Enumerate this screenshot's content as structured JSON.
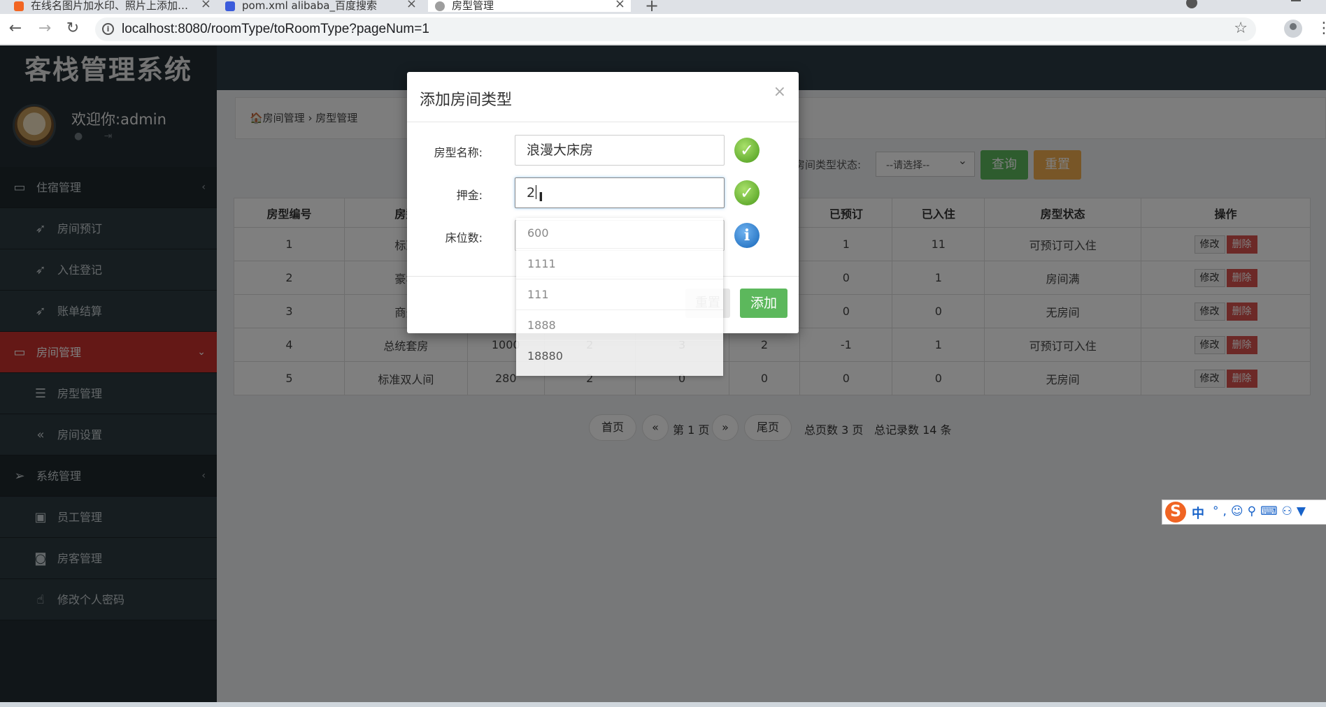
{
  "browser": {
    "tabs": [
      {
        "label": "在线名图片加水印、照片上添加…",
        "color": "#f26522"
      },
      {
        "label": "pom.xml alibaba_百度搜索",
        "color": "#3b5bdb"
      },
      {
        "label": "房型管理",
        "color": "#9e9e9e"
      }
    ],
    "url": "localhost:8080/roomType/toRoomType?pageNum=1"
  },
  "sidebar": {
    "logo": "客栈管理系统",
    "welcome": "欢迎你:admin",
    "menu": [
      {
        "label": "住宿管理",
        "icon": "laptop-icon",
        "glyph": "▭",
        "type": "header",
        "chevron": "‹"
      },
      {
        "label": "房间预订",
        "icon": "rocket-icon",
        "glyph": "➶",
        "type": "sub"
      },
      {
        "label": "入住登记",
        "icon": "rocket-icon",
        "glyph": "➶",
        "type": "sub"
      },
      {
        "label": "账单结算",
        "icon": "rocket-icon",
        "glyph": "➶",
        "type": "sub"
      },
      {
        "label": "房间管理",
        "icon": "desktop-icon",
        "glyph": "▭",
        "type": "active",
        "chevron": "⌄"
      },
      {
        "label": "房型管理",
        "icon": "list-icon",
        "glyph": "☰",
        "type": "sub"
      },
      {
        "label": "房间设置",
        "icon": "double-angle-left-icon",
        "glyph": "«",
        "type": "sub"
      },
      {
        "label": "系统管理",
        "icon": "paper-plane-icon",
        "glyph": "➢",
        "type": "header",
        "chevron": "‹"
      },
      {
        "label": "员工管理",
        "icon": "briefcase-icon",
        "glyph": "▣",
        "type": "sub"
      },
      {
        "label": "房客管理",
        "icon": "camera-icon",
        "glyph": "◙",
        "type": "sub"
      },
      {
        "label": "修改个人密码",
        "icon": "hand-pointer-icon",
        "glyph": "☝",
        "type": "sub"
      }
    ]
  },
  "main": {
    "breadcrumb": "🏠房间管理 › 房型管理",
    "filter": {
      "label": "房间类型状态:",
      "select": "--请选择--",
      "query": "查询",
      "reset": "重置"
    },
    "table": {
      "headers": [
        "房型编号",
        "房型",
        "",
        "",
        "",
        "",
        "已预订",
        "已入住",
        "房型状态",
        "操作"
      ],
      "rows": [
        [
          "1",
          "标准",
          "",
          "",
          "",
          "",
          "1",
          "11",
          "可预订可入住"
        ],
        [
          "2",
          "豪华",
          "",
          "",
          "",
          "",
          "0",
          "1",
          "房间满"
        ],
        [
          "3",
          "商务",
          "",
          "",
          "",
          "",
          "0",
          "0",
          "无房间"
        ],
        [
          "4",
          "总统套房",
          "1000",
          "2",
          "3",
          "2",
          "-1",
          "1",
          "可预订可入住"
        ],
        [
          "5",
          "标准双人间",
          "280",
          "2",
          "0",
          "0",
          "0",
          "0",
          "无房间"
        ]
      ],
      "edit": "修改",
      "delete": "删除"
    },
    "pager": {
      "first": "首页",
      "prev": "«",
      "current": "第 1 页",
      "next": "»",
      "last": "尾页",
      "total_pages": "总页数 3 页",
      "total_records": "总记录数 14 条"
    }
  },
  "modal": {
    "title": "添加房间类型",
    "close": "×",
    "fields": {
      "name_label": "房型名称:",
      "name_value": "浪漫大床房",
      "deposit_label": "押金:",
      "deposit_value": "2",
      "beds_label": "床位数:"
    },
    "autocomplete": [
      "600",
      "1111",
      "111",
      "1888",
      "18880"
    ],
    "reset": "重置",
    "add": "添加"
  },
  "ime": {
    "logo": "S",
    "mode": "中"
  }
}
